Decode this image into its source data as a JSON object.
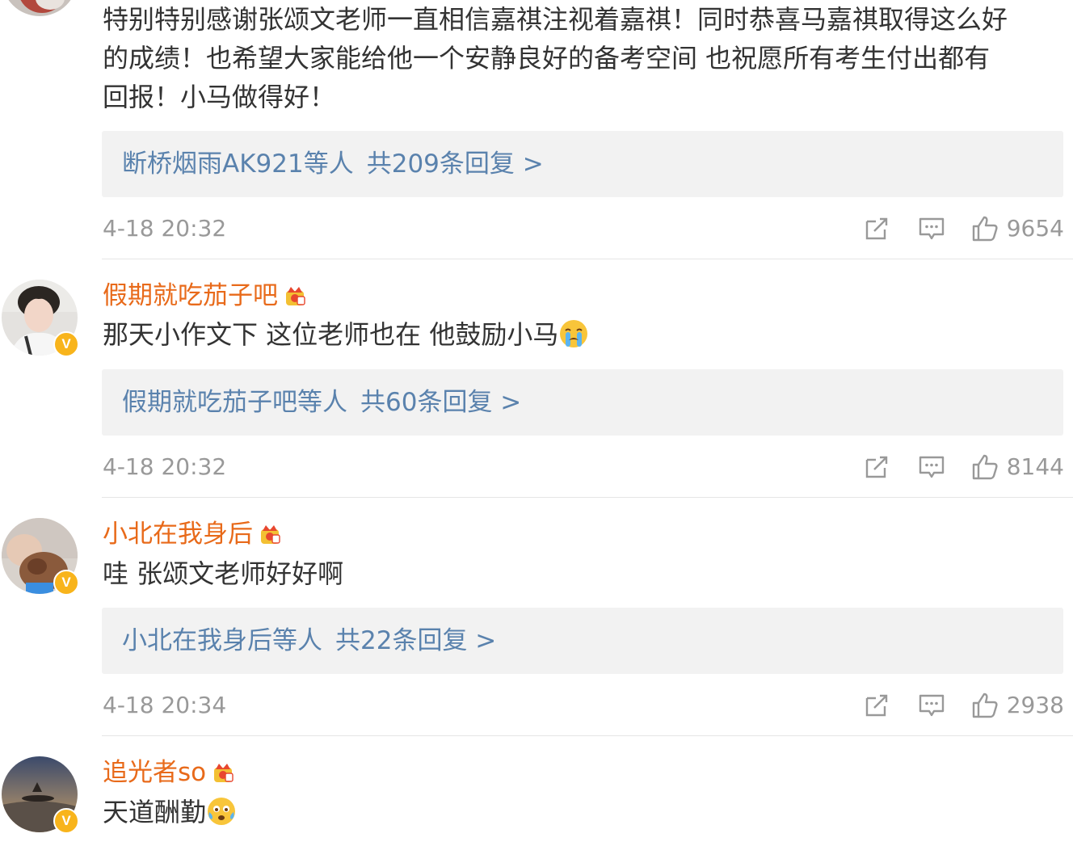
{
  "comments": [
    {
      "username": "",
      "text_lines": [
        "特别特别感谢张颂文老师一直相信嘉祺注视着嘉祺！同时恭喜马嘉祺取得这么好",
        "的成绩！也希望大家能给他一个安静良好的备考空间 也祝愿所有考生付出都有",
        "回报！小马做得好！"
      ],
      "reply_users": "断桥烟雨AK921等人",
      "reply_count": "共209条回复 >",
      "time": "4-18 20:32",
      "likes": "9654"
    },
    {
      "username": "假期就吃茄子吧",
      "text": "那天小作文下 这位老师也在 他鼓励小马",
      "emoji": "crying-face-emoji",
      "reply_users": "假期就吃茄子吧等人",
      "reply_count": "共60条回复 >",
      "time": "4-18 20:32",
      "likes": "8144"
    },
    {
      "username": "小北在我身后",
      "text": "哇 张颂文老师好好啊",
      "reply_users": "小北在我身后等人",
      "reply_count": "共22条回复 >",
      "time": "4-18 20:34",
      "likes": "2938"
    },
    {
      "username": "追光者so",
      "text": "天道酬勤",
      "emoji": "tearful-face-emoji",
      "verified_badge": "V"
    }
  ],
  "colors": {
    "username": "#e86a1a",
    "reply_link": "#5a82ad",
    "meta_gray": "#999999",
    "body_text": "#333333",
    "reply_bg": "#f2f2f2",
    "badge": "#f8b41b"
  }
}
